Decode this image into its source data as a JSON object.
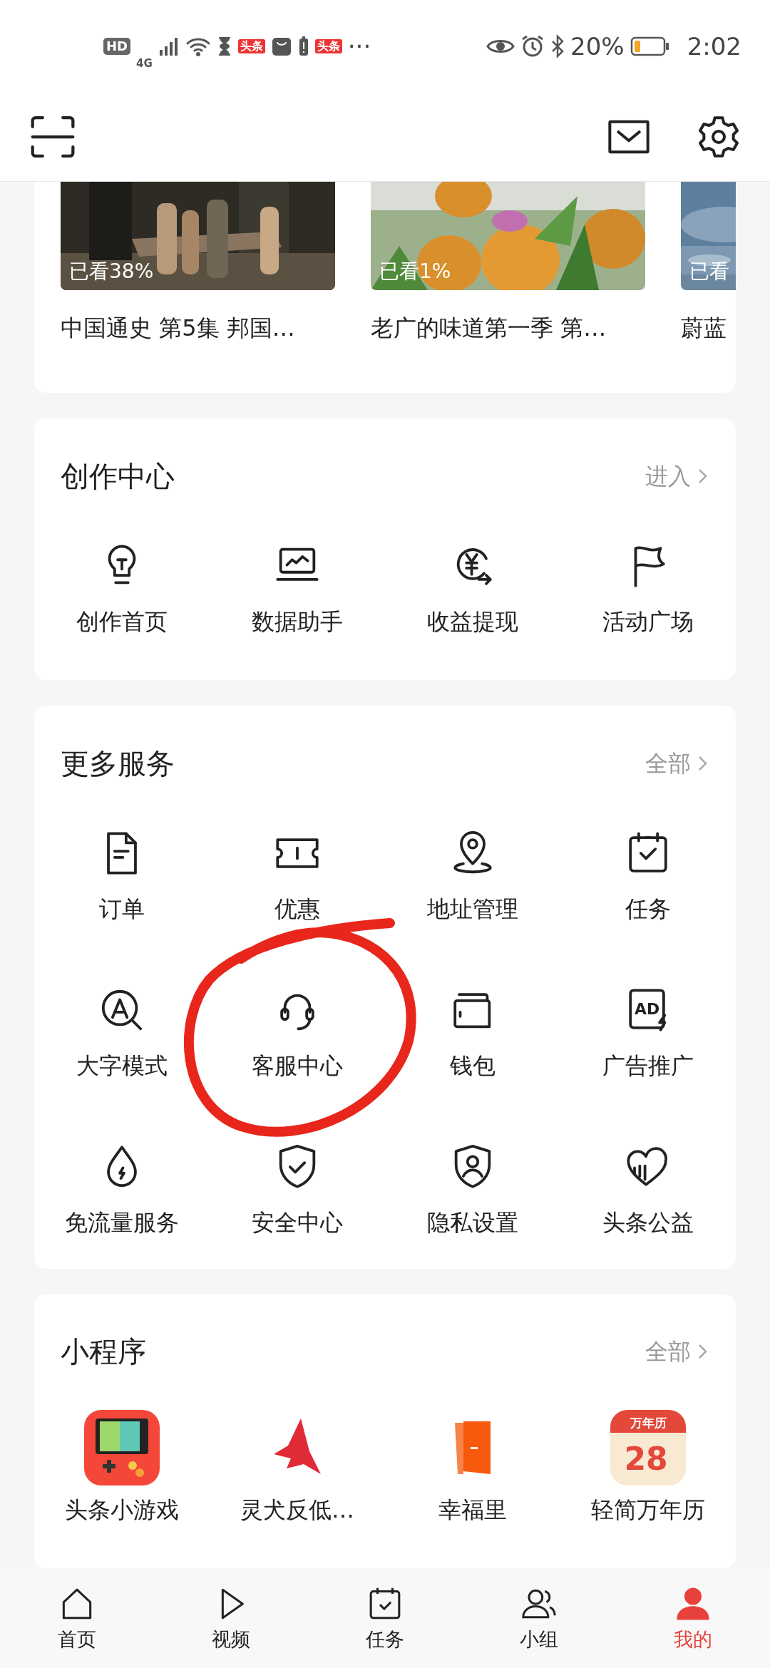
{
  "status_bar": {
    "hd_label": "HD",
    "network_label": "4G",
    "app_badges": [
      "头条",
      "头条"
    ],
    "more": "···",
    "battery_percent": "20%",
    "time": "2:02"
  },
  "watch_history": [
    {
      "progress": "已看38%",
      "title": "中国通史 第5集 邦国…"
    },
    {
      "progress": "已看1%",
      "title": "老广的味道第一季 第…"
    },
    {
      "progress": "已看",
      "title": "蔚蓝"
    }
  ],
  "sections": [
    {
      "title": "创作中心",
      "link": "进入",
      "items": [
        {
          "label": "创作首页"
        },
        {
          "label": "数据助手"
        },
        {
          "label": "收益提现"
        },
        {
          "label": "活动广场"
        }
      ]
    },
    {
      "title": "更多服务",
      "link": "全部",
      "items": [
        {
          "label": "订单"
        },
        {
          "label": "优惠"
        },
        {
          "label": "地址管理"
        },
        {
          "label": "任务"
        },
        {
          "label": "大字模式"
        },
        {
          "label": "客服中心"
        },
        {
          "label": "钱包"
        },
        {
          "label": "广告推广",
          "icon_text": "AD"
        },
        {
          "label": "免流量服务"
        },
        {
          "label": "安全中心"
        },
        {
          "label": "隐私设置"
        },
        {
          "label": "头条公益"
        }
      ]
    }
  ],
  "mini_programs": {
    "title": "小程序",
    "link": "全部",
    "items": [
      {
        "label": "头条小游戏"
      },
      {
        "label": "灵犬反低…"
      },
      {
        "label": "幸福里"
      },
      {
        "label": "轻简万年历",
        "icon_text": [
          "万年历",
          "28"
        ]
      }
    ]
  },
  "bottom_nav": [
    {
      "label": "首页",
      "selected": false
    },
    {
      "label": "视频",
      "selected": false
    },
    {
      "label": "任务",
      "selected": false
    },
    {
      "label": "小组",
      "selected": false
    },
    {
      "label": "我的",
      "selected": true
    }
  ]
}
